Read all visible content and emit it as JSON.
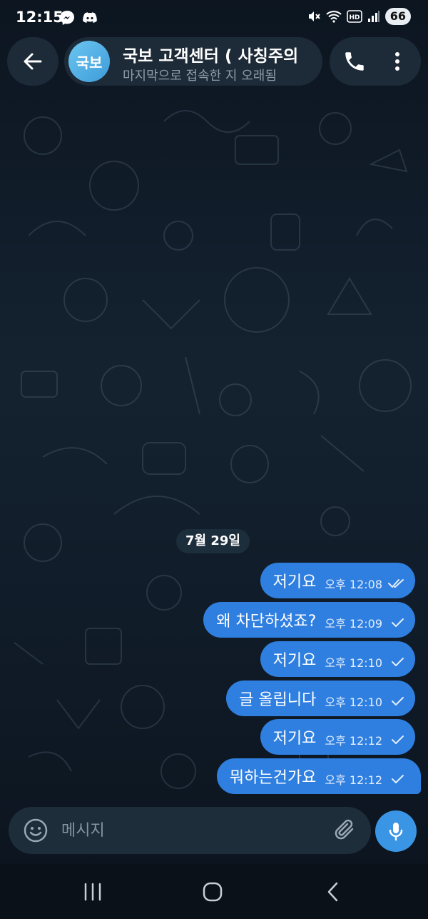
{
  "status_bar": {
    "time": "12:15",
    "left_icons": [
      "messenger-icon",
      "discord-icon"
    ],
    "right_icons": [
      "mute-icon",
      "wifi-icon",
      "hd-icon",
      "signal-icon"
    ],
    "battery": "66"
  },
  "header": {
    "avatar_text": "국보",
    "title": "국보 고객센터 ( 사칭주의",
    "subtitle": "마지막으로 접속한 지 오래됨",
    "avatar_color": "#4aa8e3"
  },
  "date_chip": "7월 29일",
  "messages": [
    {
      "text": "저기요",
      "time": "오후 12:08",
      "status": "read"
    },
    {
      "text": "왜 차단하셨죠?",
      "time": "오후 12:09",
      "status": "sent"
    },
    {
      "text": "저기요",
      "time": "오후 12:10",
      "status": "sent"
    },
    {
      "text": "글 올립니다",
      "time": "오후 12:10",
      "status": "sent"
    },
    {
      "text": "저기요",
      "time": "오후 12:12",
      "status": "sent"
    },
    {
      "text": "뭐하는건가요",
      "time": "오후 12:12",
      "status": "sent"
    }
  ],
  "input": {
    "placeholder": "메시지"
  },
  "colors": {
    "bubble": "#2f7fe0",
    "accent": "#3a95e4",
    "background": "#0e1621"
  }
}
